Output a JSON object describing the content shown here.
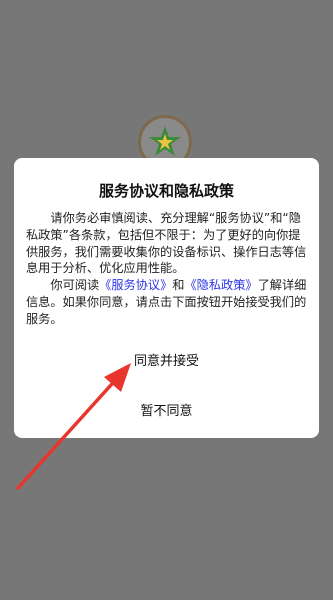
{
  "dialog": {
    "title": "服务协议和隐私政策",
    "para1": "请你务必审慎阅读、充分理解“服务协议”和“隐私政策”各条款，包括但不限于：为了更好的向你提供服务，我们需要收集你的设备标识、操作日志等信息用于分析、优化应用性能。",
    "para2_prefix": "你可阅读",
    "service_link": "《服务协议》",
    "para2_and": "和",
    "privacy_link": "《隐私政策》",
    "para2_suffix": "了解详细信息。如果你同意，请点击下面按钮开始接受我们的服务。",
    "agree_button": "同意并接受",
    "disagree_button": "暂不同意"
  },
  "colors": {
    "overlay": "#777777",
    "link": "#2a35e6",
    "annotation_arrow": "#e8362e"
  },
  "icons": {
    "splash_logo": "star-leaf-logo",
    "annotation": "red-arrow-annotation"
  }
}
